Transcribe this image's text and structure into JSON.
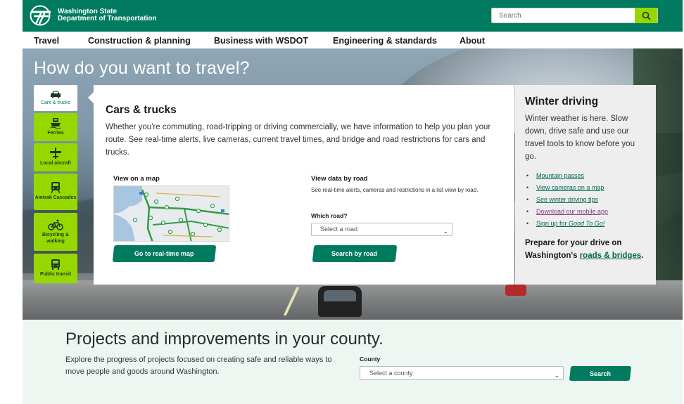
{
  "brand": {
    "name_line1": "Washington State",
    "name_line2": "Department of Transportation",
    "accent": "#007b5f",
    "lime": "#97d700"
  },
  "search": {
    "placeholder": "Search",
    "button_icon": "search-icon"
  },
  "nav": {
    "items": [
      "Travel",
      "Construction & planning",
      "Business with WSDOT",
      "Engineering & standards",
      "About"
    ]
  },
  "hero": {
    "title": "How do you want to travel?",
    "modes": [
      {
        "label": "Cars & trucks",
        "icon": "car-icon",
        "active": true
      },
      {
        "label": "Ferries",
        "icon": "ferry-icon",
        "active": false
      },
      {
        "label": "Local aircraft",
        "icon": "airplane-icon",
        "active": false
      },
      {
        "label": "Amtrak Cascades",
        "icon": "train-icon",
        "active": false
      },
      {
        "label": "Bicycling & walking",
        "icon": "bicycle-icon",
        "active": false
      },
      {
        "label": "Public transit",
        "icon": "bus-icon",
        "active": false
      }
    ]
  },
  "panel": {
    "title": "Cars & trucks",
    "description": "Whether you're commuting, road-tripping or driving commercially, we have information to help you plan your route. See real-time alerts, live cameras, current travel times, and bridge and road restrictions for cars and trucks.",
    "map_heading": "View on a map",
    "map_button": "Go to real-time map",
    "data_heading": "View data by road",
    "data_description": "See real-time alerts, cameras and restrictions in a list view by road.",
    "which_road_label": "Which road?",
    "road_select_value": "Select a road",
    "road_button": "Search by road"
  },
  "winter": {
    "title": "Winter driving",
    "text": "Winter weather is here. Slow down, drive safe and use our travel tools to know before you go.",
    "links": [
      "Mountain passes",
      "View cameras on a map",
      "See winter driving tips",
      "Download our mobile app"
    ],
    "signup_prefix": "Sign up for ",
    "signup_link": "Good To Go!",
    "prepare_text": "Prepare for your drive on Washington's ",
    "prepare_link": "roads & bridges",
    "prepare_end": "."
  },
  "projects": {
    "title": "Projects and improvements in your county.",
    "description": "Explore the progress of projects focused on creating safe and reliable ways to move people and goods around Washington.",
    "county_label": "County",
    "county_select_value": "Select a county",
    "search_button": "Search"
  }
}
